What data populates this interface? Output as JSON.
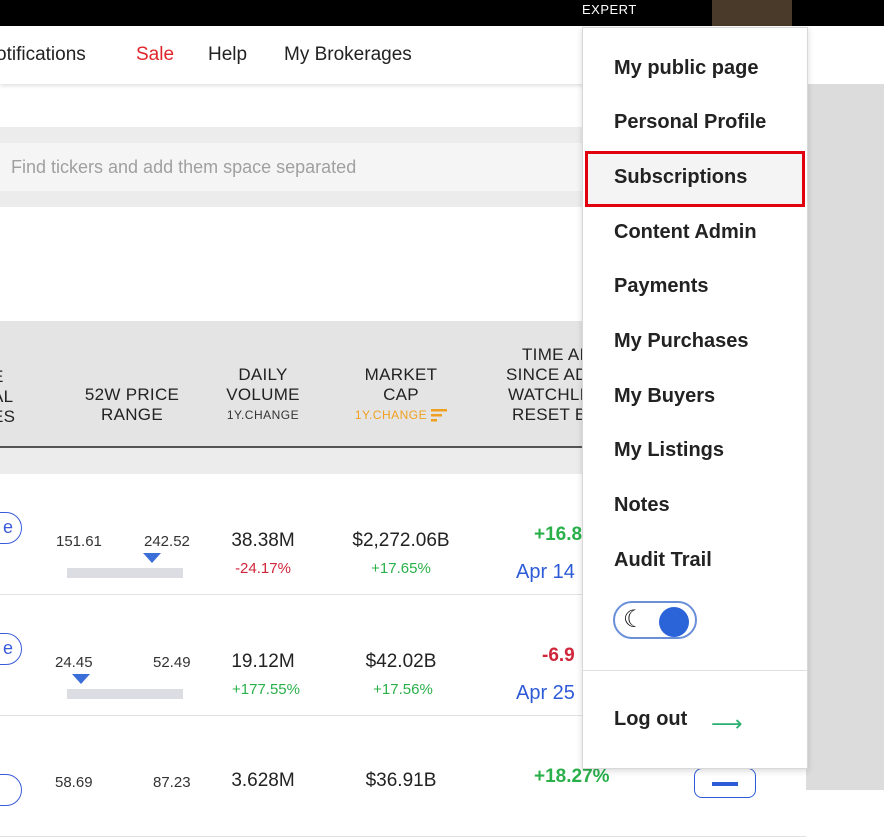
{
  "topbar": {
    "badge": "EXPERT"
  },
  "nav": {
    "notifications": "otifications",
    "sale": "Sale",
    "help": "Help",
    "brokerages": "My Brokerages"
  },
  "search": {
    "placeholder": "Find tickers and add them space separated"
  },
  "table": {
    "headers": {
      "col0_l1": "E",
      "col0_l2": "AL",
      "col0_l3": "ES",
      "range_l1": "52W PRICE",
      "range_l2": "RANGE",
      "vol_l1": "DAILY",
      "vol_l2": "VOLUME",
      "vol_sub": "1Y.CHANGE",
      "cap_l1": "MARKET",
      "cap_l2": "CAP",
      "cap_sub": "1Y.CHANGE",
      "time_l1": "TIME AI",
      "time_l2": "SINCE AD",
      "time_l3": "WATCHLI",
      "time_l4": "RESET B"
    },
    "rows": [
      {
        "pill": "e",
        "low": "151.61",
        "high": "242.52",
        "range_pos": 0.74,
        "volume": "38.38M",
        "vol_change": "-24.17%",
        "cap": "$2,272.06B",
        "cap_change": "+17.65%",
        "since_change": "+16.8",
        "since_date": "Apr 14"
      },
      {
        "pill": "e",
        "low": "24.45",
        "high": "52.49",
        "range_pos": 0.12,
        "volume": "19.12M",
        "vol_change": "+177.55%",
        "cap": "$42.02B",
        "cap_change": "+17.56%",
        "since_change": "-6.9",
        "since_date": "Apr 25"
      },
      {
        "pill": "",
        "low": "58.69",
        "high": "87.23",
        "volume": "3.628M",
        "cap": "$36.91B",
        "since_change": "+18.27%"
      }
    ]
  },
  "menu": {
    "items": [
      "My public page",
      "Personal Profile",
      "Subscriptions",
      "Content Admin",
      "Payments",
      "My Purchases",
      "My Buyers",
      "My Listings",
      "Notes",
      "Audit Trail"
    ],
    "active_item": "Subscriptions",
    "theme_icon": "moon-icon",
    "logout": "Log out"
  },
  "colors": {
    "sale": "#e0262b",
    "highlight_border": "#e0000e",
    "positive": "#2ab04a",
    "negative": "#d0263a",
    "link_blue": "#2d5bd8",
    "orange": "#f0a020"
  }
}
